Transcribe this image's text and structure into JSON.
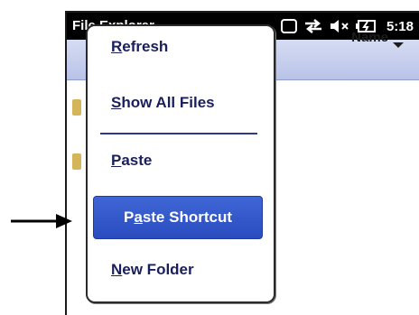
{
  "statusbar": {
    "app_title": "File Explorer",
    "time": "5:18",
    "icons": [
      "windows-icon",
      "sync-icon",
      "speaker-muted-icon",
      "battery-charging-icon"
    ]
  },
  "header": {
    "sort_label": "Name",
    "sort_icon": "chevron-down-icon"
  },
  "context_menu": {
    "items": [
      {
        "label": "Refresh",
        "accel": "R",
        "rest": "efresh"
      },
      {
        "label": "Show All Files",
        "accel": "S",
        "rest": "how All Files"
      },
      {
        "label": "Paste",
        "accel": "P",
        "rest": "aste"
      },
      {
        "label": "Paste Shortcut",
        "pre": "P",
        "accel": "a",
        "rest": "ste Shortcut",
        "highlighted": true
      },
      {
        "label": "New Folder",
        "accel": "N",
        "rest": "ew Folder"
      }
    ]
  },
  "colors": {
    "menu_text": "#1a1f5c",
    "highlight": "#2f55c9",
    "header_bg": "#c9d0ee",
    "statusbar_bg": "#000000"
  }
}
